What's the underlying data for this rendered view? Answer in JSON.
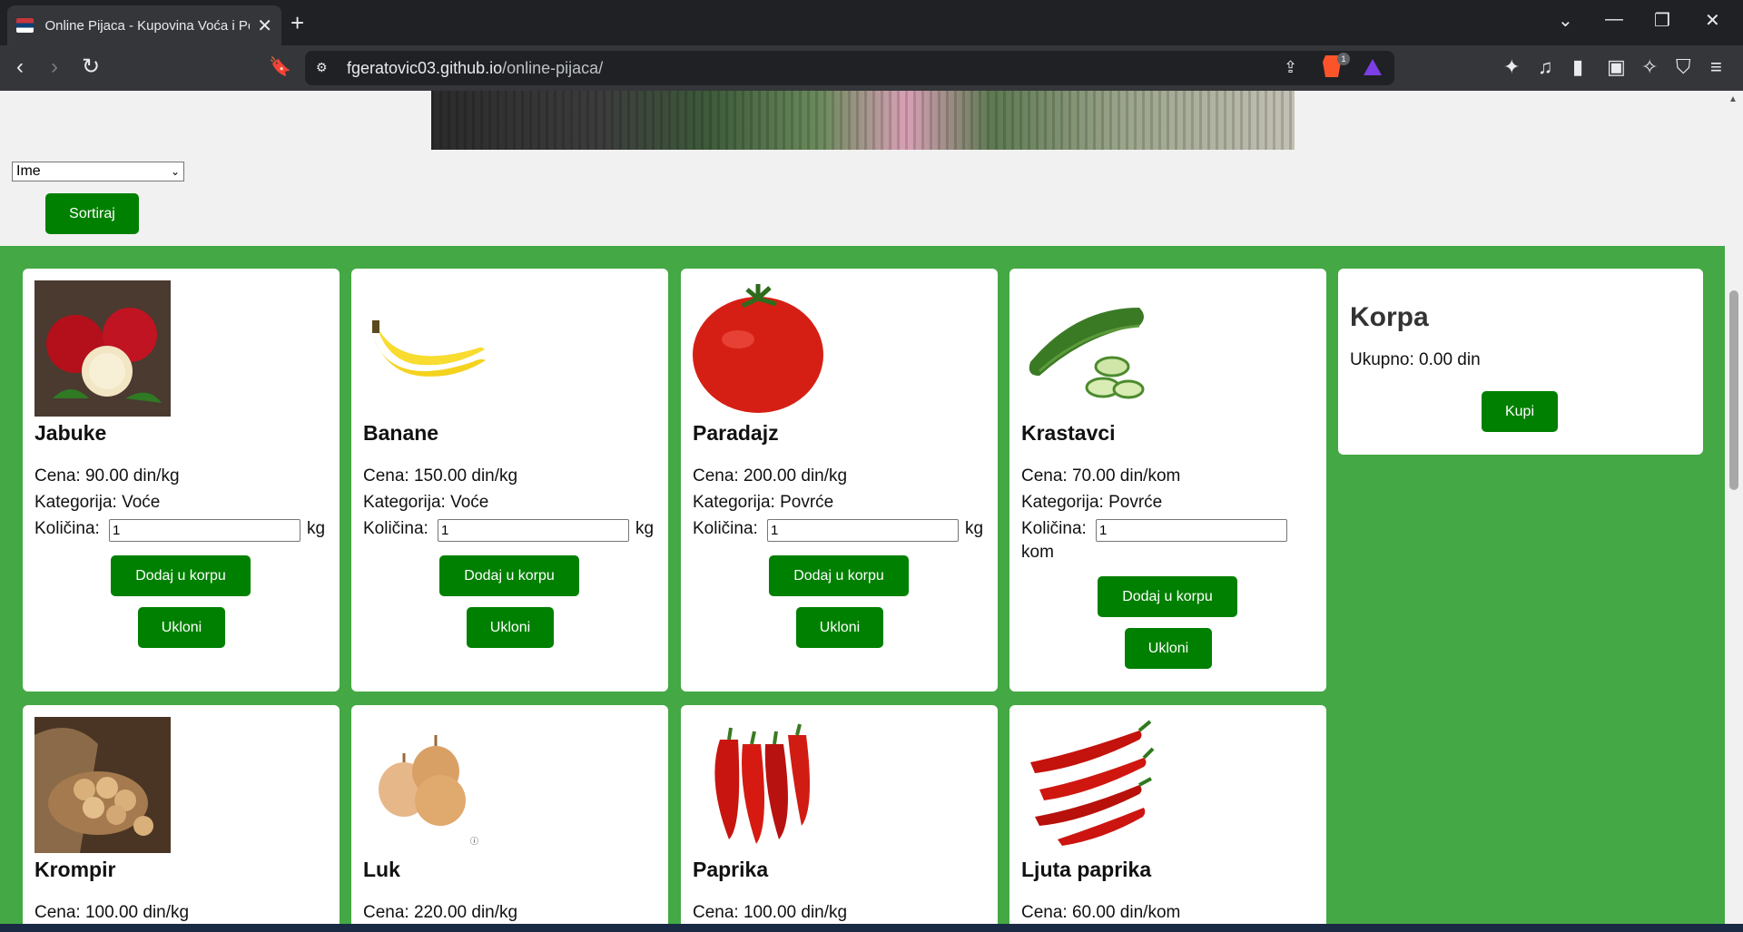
{
  "browser": {
    "tab_title": "Online Pijaca - Kupovina Voća i Povrća",
    "new_tab": "+",
    "close_tab": "✕",
    "url_host": "fgeratovic03.github.io",
    "url_path": "/online-pijaca/",
    "brave_badge": "1"
  },
  "sort": {
    "selected": "Ime",
    "button_label": "Sortiraj"
  },
  "products": [
    {
      "name": "Jabuke",
      "price": "Cena: 90.00 din/kg",
      "category": "Kategorija: Voće",
      "qty_label": "Količina:",
      "qty_value": "1",
      "unit": "kg",
      "add": "Dodaj u korpu",
      "remove": "Ukloni",
      "icon": "apple-image"
    },
    {
      "name": "Banane",
      "price": "Cena: 150.00 din/kg",
      "category": "Kategorija: Voće",
      "qty_label": "Količina:",
      "qty_value": "1",
      "unit": "kg",
      "add": "Dodaj u korpu",
      "remove": "Ukloni",
      "icon": "banana-image"
    },
    {
      "name": "Paradajz",
      "price": "Cena: 200.00 din/kg",
      "category": "Kategorija: Povrće",
      "qty_label": "Količina:",
      "qty_value": "1",
      "unit": "kg",
      "add": "Dodaj u korpu",
      "remove": "Ukloni",
      "icon": "tomato-image"
    },
    {
      "name": "Krastavci",
      "price": "Cena: 70.00 din/kom",
      "category": "Kategorija: Povrće",
      "qty_label": "Količina:",
      "qty_value": "1",
      "unit": "kom",
      "add": "Dodaj u korpu",
      "remove": "Ukloni",
      "icon": "cucumber-image"
    },
    {
      "name": "Krompir",
      "price": "Cena: 100.00 din/kg",
      "icon": "potato-image"
    },
    {
      "name": "Luk",
      "price": "Cena: 220.00 din/kg",
      "icon": "onion-image"
    },
    {
      "name": "Paprika",
      "price": "Cena: 100.00 din/kg",
      "icon": "pepper-image"
    },
    {
      "name": "Ljuta paprika",
      "price": "Cena: 60.00 din/kom",
      "icon": "chili-image"
    }
  ],
  "cart": {
    "title": "Korpa",
    "total": "Ukupno: 0.00 din",
    "buy": "Kupi"
  },
  "colors": {
    "accent_green": "#008000",
    "background_green": "#44a844"
  }
}
